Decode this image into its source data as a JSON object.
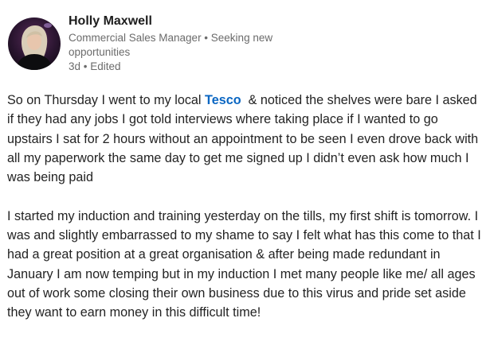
{
  "author": {
    "name": "Holly Maxwell",
    "headline": "Commercial Sales Manager • Seeking new opportunities",
    "time": "3d",
    "separator": " • ",
    "edited": "Edited"
  },
  "post": {
    "p1_before": "So on Thursday I went to my local ",
    "p1_mention": "Tesco",
    "p1_after": "  & noticed the shelves were bare I asked if they had any jobs I got told interviews where taking place if I wanted to go upstairs I sat for 2 hours without an appointment to be seen I even drove back with all my paperwork the same day to get me signed up I didn’t even ask how much I was being paid",
    "p2": "I started my induction and training yesterday on the tills, my first shift is tomorrow. I was and slightly embarrassed to my shame to say I felt what has this come to that I had a great position at a great organisation & after being made redundant in January I am now temping but in my induction I met many people like me/ all ages out of work some closing their own business due to this virus and pride set aside they want to earn money in this difficult time!"
  },
  "colors": {
    "mention": "#0a66c2",
    "meta_text": "#6b6b6b",
    "body_text": "#232323"
  }
}
